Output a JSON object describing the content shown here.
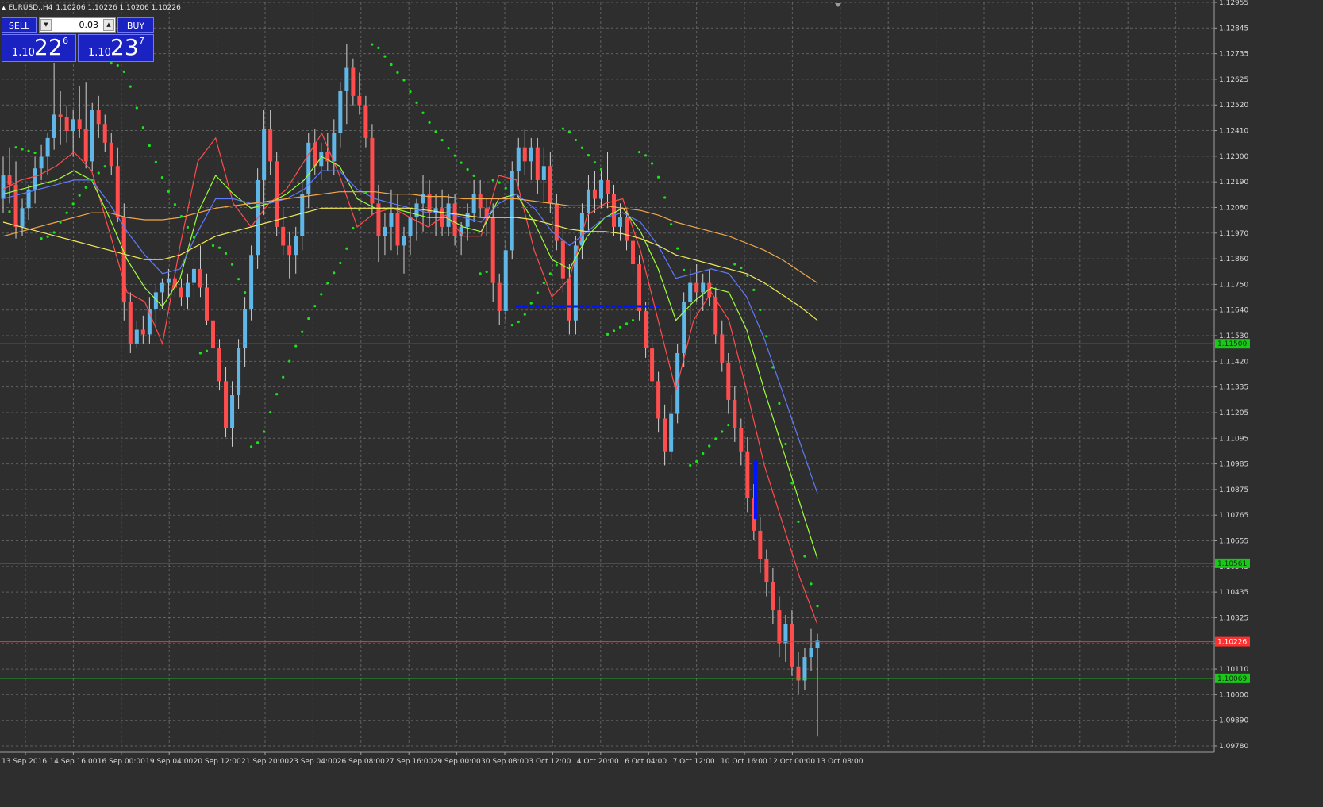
{
  "window": {
    "symbol_title": "EURUSD.,H4",
    "quote": "1.10206 1.10226 1.10206 1.10226"
  },
  "trade_panel": {
    "sell_label": "SELL",
    "buy_label": "BUY",
    "lot_value": "0.03",
    "sell_price": {
      "prefix": "1.10",
      "big": "22",
      "pipette": "6"
    },
    "buy_price": {
      "prefix": "1.10",
      "big": "23",
      "pipette": "7"
    },
    "colors": {
      "button": "#1a22c2",
      "border": "#6f78ff"
    }
  },
  "chart_data": {
    "type": "candlestick",
    "symbol": "EURUSD.",
    "timeframe": "H4",
    "ylim": [
      1.0978,
      1.1296
    ],
    "price_ticks": [
      "1.12955",
      "1.12845",
      "1.12735",
      "1.12625",
      "1.12520",
      "1.12410",
      "1.12300",
      "1.12190",
      "1.12080",
      "1.11970",
      "1.11860",
      "1.11750",
      "1.11640",
      "1.11530",
      "1.11420",
      "1.11335",
      "1.11205",
      "1.11095",
      "1.10985",
      "1.10875",
      "1.10765",
      "1.10655",
      "1.10545",
      "1.10435",
      "1.10325",
      "1.10215",
      "1.10110",
      "1.10000",
      "1.09890",
      "1.09780"
    ],
    "time_ticks": [
      "13 Sep 2016",
      "14 Sep 16:00",
      "16 Sep 00:00",
      "19 Sep 04:00",
      "20 Sep 12:00",
      "21 Sep 20:00",
      "23 Sep 04:00",
      "26 Sep 08:00",
      "27 Sep 16:00",
      "29 Sep 00:00",
      "30 Sep 08:00",
      "3 Oct 12:00",
      "4 Oct 20:00",
      "6 Oct 04:00",
      "7 Oct 12:00",
      "10 Oct 16:00",
      "12 Oct 00:00",
      "13 Oct 08:00"
    ],
    "candles": [
      [
        1.1212,
        1.123,
        1.1206,
        1.1222
      ],
      [
        1.1222,
        1.1234,
        1.121,
        1.1218
      ],
      [
        1.1218,
        1.1228,
        1.1195,
        1.12
      ],
      [
        1.12,
        1.1212,
        1.1196,
        1.1208
      ],
      [
        1.1208,
        1.1218,
        1.1203,
        1.1216
      ],
      [
        1.1216,
        1.123,
        1.121,
        1.1225
      ],
      [
        1.1225,
        1.1235,
        1.122,
        1.123
      ],
      [
        1.123,
        1.124,
        1.1222,
        1.1238
      ],
      [
        1.1238,
        1.127,
        1.1233,
        1.1248
      ],
      [
        1.1248,
        1.1258,
        1.1235,
        1.1247
      ],
      [
        1.1247,
        1.1252,
        1.1236,
        1.1241
      ],
      [
        1.1241,
        1.125,
        1.123,
        1.1246
      ],
      [
        1.1246,
        1.126,
        1.1238,
        1.1242
      ],
      [
        1.1242,
        1.1262,
        1.1225,
        1.1228
      ],
      [
        1.1228,
        1.1253,
        1.1224,
        1.125
      ],
      [
        1.125,
        1.1256,
        1.1238,
        1.1244
      ],
      [
        1.1244,
        1.1248,
        1.1232,
        1.1236
      ],
      [
        1.1236,
        1.124,
        1.1222,
        1.1226
      ],
      [
        1.1226,
        1.1234,
        1.1202,
        1.1204
      ],
      [
        1.1204,
        1.121,
        1.116,
        1.1168
      ],
      [
        1.1168,
        1.1172,
        1.1146,
        1.115
      ],
      [
        1.115,
        1.116,
        1.1148,
        1.1156
      ],
      [
        1.1156,
        1.1162,
        1.115,
        1.1154
      ],
      [
        1.1154,
        1.117,
        1.115,
        1.1165
      ],
      [
        1.1165,
        1.1175,
        1.1158,
        1.1172
      ],
      [
        1.1172,
        1.1178,
        1.1165,
        1.1176
      ],
      [
        1.1176,
        1.1182,
        1.117,
        1.1178
      ],
      [
        1.1178,
        1.1182,
        1.117,
        1.1174
      ],
      [
        1.1174,
        1.1178,
        1.1166,
        1.117
      ],
      [
        1.117,
        1.118,
        1.1165,
        1.1176
      ],
      [
        1.1176,
        1.1188,
        1.1168,
        1.1182
      ],
      [
        1.1182,
        1.1192,
        1.117,
        1.1174
      ],
      [
        1.1174,
        1.118,
        1.1158,
        1.116
      ],
      [
        1.116,
        1.1165,
        1.1145,
        1.1148
      ],
      [
        1.1148,
        1.1152,
        1.113,
        1.1134
      ],
      [
        1.1134,
        1.114,
        1.111,
        1.1114
      ],
      [
        1.1114,
        1.1134,
        1.1106,
        1.1128
      ],
      [
        1.1128,
        1.1152,
        1.1122,
        1.1148
      ],
      [
        1.1148,
        1.117,
        1.114,
        1.1165
      ],
      [
        1.1165,
        1.1192,
        1.116,
        1.1188
      ],
      [
        1.1188,
        1.1225,
        1.1182,
        1.122
      ],
      [
        1.122,
        1.125,
        1.1205,
        1.1242
      ],
      [
        1.1242,
        1.125,
        1.1222,
        1.1228
      ],
      [
        1.1228,
        1.1232,
        1.1196,
        1.12
      ],
      [
        1.12,
        1.1208,
        1.1188,
        1.1192
      ],
      [
        1.1192,
        1.1198,
        1.1178,
        1.1188
      ],
      [
        1.1188,
        1.12,
        1.118,
        1.1196
      ],
      [
        1.1196,
        1.122,
        1.119,
        1.1214
      ],
      [
        1.1214,
        1.124,
        1.1208,
        1.1236
      ],
      [
        1.1236,
        1.1242,
        1.1222,
        1.1226
      ],
      [
        1.1226,
        1.1236,
        1.122,
        1.1232
      ],
      [
        1.1232,
        1.124,
        1.1224,
        1.1228
      ],
      [
        1.1228,
        1.1246,
        1.1222,
        1.124
      ],
      [
        1.124,
        1.1262,
        1.1234,
        1.1258
      ],
      [
        1.1258,
        1.1278,
        1.1244,
        1.1268
      ],
      [
        1.1268,
        1.1272,
        1.1252,
        1.1256
      ],
      [
        1.1256,
        1.1266,
        1.1248,
        1.1252
      ],
      [
        1.1252,
        1.1256,
        1.1234,
        1.1238
      ],
      [
        1.1238,
        1.1244,
        1.1205,
        1.121
      ],
      [
        1.121,
        1.1218,
        1.1185,
        1.1196
      ],
      [
        1.1196,
        1.1206,
        1.1188,
        1.12
      ],
      [
        1.12,
        1.1216,
        1.119,
        1.1206
      ],
      [
        1.1206,
        1.1214,
        1.1188,
        1.1192
      ],
      [
        1.1192,
        1.12,
        1.118,
        1.1196
      ],
      [
        1.1196,
        1.1208,
        1.1188,
        1.1204
      ],
      [
        1.1204,
        1.1212,
        1.1194,
        1.121
      ],
      [
        1.121,
        1.1222,
        1.1198,
        1.1214
      ],
      [
        1.1214,
        1.122,
        1.12,
        1.1206
      ],
      [
        1.1206,
        1.1214,
        1.1196,
        1.1208
      ],
      [
        1.1208,
        1.1216,
        1.1196,
        1.12
      ],
      [
        1.12,
        1.1214,
        1.1196,
        1.121
      ],
      [
        1.121,
        1.1214,
        1.1192,
        1.1196
      ],
      [
        1.1196,
        1.1202,
        1.1188,
        1.12
      ],
      [
        1.12,
        1.121,
        1.1194,
        1.1206
      ],
      [
        1.1206,
        1.122,
        1.1202,
        1.1214
      ],
      [
        1.1214,
        1.122,
        1.1204,
        1.1208
      ],
      [
        1.1208,
        1.1212,
        1.1196,
        1.1204
      ],
      [
        1.1204,
        1.121,
        1.1168,
        1.1176
      ],
      [
        1.1176,
        1.118,
        1.1158,
        1.1164
      ],
      [
        1.1164,
        1.1194,
        1.116,
        1.119
      ],
      [
        1.119,
        1.1228,
        1.1186,
        1.1224
      ],
      [
        1.1224,
        1.1238,
        1.1216,
        1.1234
      ],
      [
        1.1234,
        1.1242,
        1.1222,
        1.1228
      ],
      [
        1.1228,
        1.1238,
        1.122,
        1.1234
      ],
      [
        1.1234,
        1.1238,
        1.1214,
        1.122
      ],
      [
        1.122,
        1.1234,
        1.121,
        1.1226
      ],
      [
        1.1226,
        1.1232,
        1.1206,
        1.121
      ],
      [
        1.121,
        1.1214,
        1.119,
        1.1194
      ],
      [
        1.1194,
        1.12,
        1.1172,
        1.1178
      ],
      [
        1.1178,
        1.1184,
        1.1154,
        1.116
      ],
      [
        1.116,
        1.1196,
        1.1154,
        1.1192
      ],
      [
        1.1192,
        1.121,
        1.1186,
        1.1206
      ],
      [
        1.1206,
        1.1222,
        1.1198,
        1.1216
      ],
      [
        1.1216,
        1.1224,
        1.1206,
        1.1212
      ],
      [
        1.1212,
        1.1224,
        1.1208,
        1.122
      ],
      [
        1.122,
        1.1232,
        1.1208,
        1.1214
      ],
      [
        1.1214,
        1.1218,
        1.1196,
        1.12
      ],
      [
        1.12,
        1.121,
        1.1194,
        1.1204
      ],
      [
        1.1204,
        1.1208,
        1.119,
        1.1194
      ],
      [
        1.1194,
        1.1202,
        1.118,
        1.1184
      ],
      [
        1.1184,
        1.1188,
        1.116,
        1.1164
      ],
      [
        1.1164,
        1.1168,
        1.1144,
        1.1148
      ],
      [
        1.1148,
        1.1152,
        1.113,
        1.1134
      ],
      [
        1.1134,
        1.1138,
        1.1112,
        1.1118
      ],
      [
        1.1118,
        1.1124,
        1.1098,
        1.1104
      ],
      [
        1.1104,
        1.1128,
        1.11,
        1.112
      ],
      [
        1.112,
        1.115,
        1.1116,
        1.1146
      ],
      [
        1.1146,
        1.1172,
        1.114,
        1.1168
      ],
      [
        1.1168,
        1.1182,
        1.1158,
        1.1176
      ],
      [
        1.1176,
        1.1184,
        1.1168,
        1.1172
      ],
      [
        1.1172,
        1.118,
        1.1164,
        1.1176
      ],
      [
        1.1176,
        1.1182,
        1.1166,
        1.117
      ],
      [
        1.117,
        1.1174,
        1.115,
        1.1154
      ],
      [
        1.1154,
        1.116,
        1.1138,
        1.1142
      ],
      [
        1.1142,
        1.1146,
        1.112,
        1.1126
      ],
      [
        1.1126,
        1.1132,
        1.1108,
        1.1114
      ],
      [
        1.1114,
        1.1118,
        1.1098,
        1.1104
      ],
      [
        1.1104,
        1.111,
        1.1078,
        1.1084
      ],
      [
        1.1084,
        1.109,
        1.1066,
        1.107
      ],
      [
        1.107,
        1.1076,
        1.1052,
        1.1058
      ],
      [
        1.1058,
        1.1062,
        1.1042,
        1.1048
      ],
      [
        1.1048,
        1.1054,
        1.103,
        1.1036
      ],
      [
        1.1036,
        1.1042,
        1.1016,
        1.1022
      ],
      [
        1.1022,
        1.1034,
        1.1014,
        1.103
      ],
      [
        1.103,
        1.1036,
        1.1008,
        1.1012
      ],
      [
        1.1012,
        1.1018,
        1.1,
        1.1006
      ],
      [
        1.1006,
        1.102,
        1.1002,
        1.1016
      ],
      [
        1.1016,
        1.1028,
        1.101,
        1.102
      ],
      [
        1.102,
        1.1026,
        1.0982,
        1.1023
      ]
    ],
    "moving_averages": [
      {
        "color": "#ff4d4d",
        "values": [
          1.1216,
          1.122,
          1.1222,
          1.1226,
          1.1232,
          1.1224,
          1.1198,
          1.1172,
          1.1168,
          1.115,
          1.1192,
          1.1228,
          1.1238,
          1.121,
          1.12,
          1.121,
          1.1216,
          1.1228,
          1.124,
          1.1222,
          1.12,
          1.1206,
          1.1208,
          1.1204,
          1.12,
          1.1205,
          1.1196,
          1.1196,
          1.1222,
          1.122,
          1.119,
          1.117,
          1.1178,
          1.1205,
          1.121,
          1.1212,
          1.119,
          1.116,
          1.113,
          1.116,
          1.1172,
          1.116,
          1.113,
          1.1098,
          1.1074,
          1.105,
          1.103
        ]
      },
      {
        "color": "#9cff3a",
        "values": [
          1.1214,
          1.1216,
          1.1218,
          1.122,
          1.1224,
          1.122,
          1.1204,
          1.1186,
          1.1174,
          1.1166,
          1.1178,
          1.1206,
          1.1222,
          1.1214,
          1.1208,
          1.121,
          1.1214,
          1.122,
          1.123,
          1.1226,
          1.1212,
          1.1208,
          1.1208,
          1.1206,
          1.1204,
          1.1204,
          1.12,
          1.1198,
          1.1212,
          1.1214,
          1.1202,
          1.1186,
          1.1182,
          1.1196,
          1.1204,
          1.1208,
          1.1198,
          1.1182,
          1.116,
          1.1168,
          1.1174,
          1.1172,
          1.1156,
          1.113,
          1.1106,
          1.1082,
          1.1058
        ]
      },
      {
        "color": "#5c7bff",
        "values": [
          1.1212,
          1.1214,
          1.1216,
          1.1218,
          1.122,
          1.122,
          1.121,
          1.1198,
          1.1188,
          1.118,
          1.1182,
          1.1198,
          1.1212,
          1.1212,
          1.121,
          1.121,
          1.1212,
          1.1216,
          1.1224,
          1.1224,
          1.1216,
          1.1212,
          1.121,
          1.1208,
          1.1206,
          1.1206,
          1.1204,
          1.1202,
          1.121,
          1.1214,
          1.1208,
          1.1198,
          1.1192,
          1.1198,
          1.1204,
          1.1206,
          1.1202,
          1.1192,
          1.1178,
          1.118,
          1.1182,
          1.118,
          1.117,
          1.1152,
          1.113,
          1.1108,
          1.1086
        ]
      },
      {
        "color": "#f0ea5a",
        "values": [
          1.1202,
          1.12,
          1.1198,
          1.1196,
          1.1194,
          1.1192,
          1.119,
          1.1188,
          1.1186,
          1.1186,
          1.1188,
          1.1192,
          1.1196,
          1.1198,
          1.12,
          1.1202,
          1.1204,
          1.1206,
          1.1208,
          1.1208,
          1.1208,
          1.1208,
          1.1208,
          1.1208,
          1.1207,
          1.1206,
          1.1205,
          1.1204,
          1.1204,
          1.1204,
          1.1203,
          1.1201,
          1.1199,
          1.1198,
          1.1198,
          1.1197,
          1.1195,
          1.1192,
          1.1188,
          1.1186,
          1.1184,
          1.1182,
          1.118,
          1.1176,
          1.1171,
          1.1166,
          1.116
        ]
      },
      {
        "color": "#f0a64a",
        "values": [
          1.1196,
          1.1198,
          1.12,
          1.1202,
          1.1204,
          1.1206,
          1.1206,
          1.1204,
          1.1203,
          1.1203,
          1.1204,
          1.1206,
          1.1208,
          1.1209,
          1.121,
          1.1211,
          1.1212,
          1.1213,
          1.1214,
          1.1215,
          1.1215,
          1.1215,
          1.1214,
          1.1214,
          1.1213,
          1.1213,
          1.1212,
          1.1212,
          1.1212,
          1.1212,
          1.1211,
          1.121,
          1.1209,
          1.1209,
          1.1209,
          1.1208,
          1.1207,
          1.1205,
          1.1202,
          1.12,
          1.1198,
          1.1196,
          1.1193,
          1.119,
          1.1186,
          1.1181,
          1.1176
        ]
      }
    ],
    "sar_color": "#19e619",
    "horizontal_lines": [
      {
        "price": 1.115,
        "label": "1.11500",
        "color": "#19c819"
      },
      {
        "price": 1.10561,
        "label": "1.10561",
        "color": "#19c819"
      },
      {
        "price": 1.10226,
        "label": "1.10226",
        "color": "#ff3030"
      },
      {
        "price": 1.10069,
        "label": "1.10069",
        "color": "#19c819"
      }
    ],
    "bid_line_price": 1.10226,
    "grid": true,
    "colors": {
      "background": "#2e2e2e",
      "grid": "#8a8a8a",
      "bull": "#5fb7e8",
      "bear": "#ff4d4d",
      "axis_text": "#d9d9d9",
      "marker": "#0014ff"
    }
  }
}
